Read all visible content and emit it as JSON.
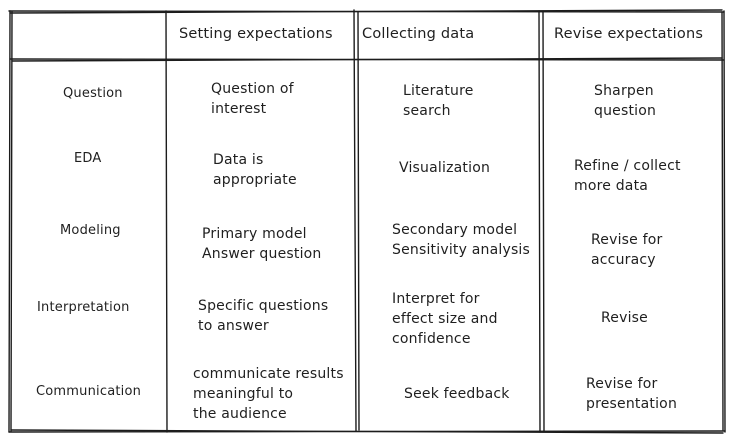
{
  "header": {
    "col1": "Setting expectations",
    "col2": "Collecting data",
    "col3": "Revise expectations"
  },
  "rows": [
    {
      "label": "Question",
      "col1": "Question of\ninterest",
      "col2": "Literature\nsearch",
      "col3": "Sharpen\nquestion"
    },
    {
      "label": "EDA",
      "col1": "Data is\nappropriate",
      "col2": "Visualization",
      "col3": "Refine / collect\nmore data"
    },
    {
      "label": "Modeling",
      "col1": "Primary model\nAnswer question",
      "col2": "Secondary model\nSensitivity analysis",
      "col3": "Revise for\naccuracy"
    },
    {
      "label": "Interpretation",
      "col1": "Specific questions\nto answer",
      "col2": "Interpret for\neffect size and\nconfidence",
      "col3": "Revise"
    },
    {
      "label": "Communication",
      "col1": "communicate results\nmeaningful to\nthe audience",
      "col2": "Seek feedback",
      "col3": "Revise for\npresentation"
    }
  ]
}
